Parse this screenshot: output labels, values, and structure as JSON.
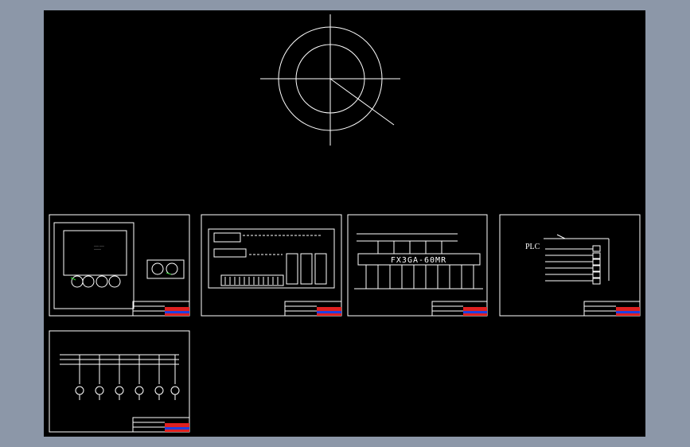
{
  "colors": {
    "background": "#8c97a8",
    "canvas": "#000000",
    "line": "#ffffff",
    "title_red": "#e02020",
    "title_blue": "#2040e0",
    "title_yellow": "#e8d020",
    "accent_green": "#30d030"
  },
  "sheets": {
    "plc_model": "FX3GA-60MR",
    "plc_label": "PLC"
  }
}
